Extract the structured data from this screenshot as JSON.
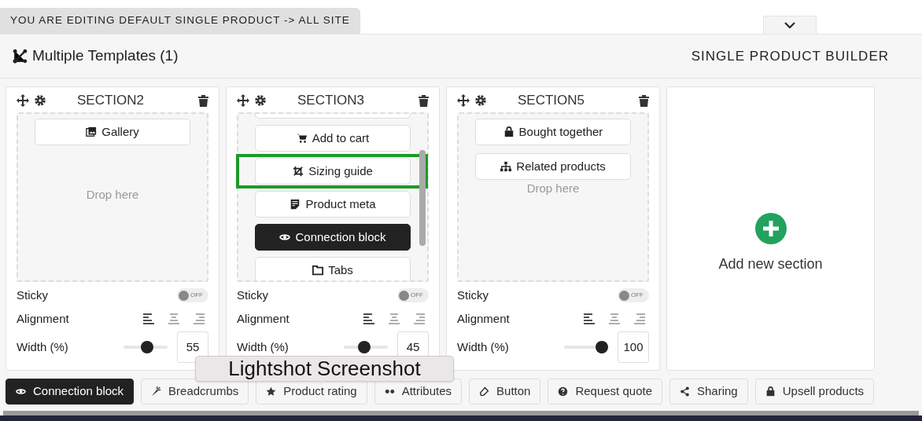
{
  "banner": {
    "text": "YOU ARE EDITING DEFAULT SINGLE PRODUCT -> ALL SITE"
  },
  "header": {
    "title": "Multiple Templates (1)",
    "builder_label": "SINGLE PRODUCT BUILDER"
  },
  "sections": [
    {
      "title": "SECTION2",
      "scrolled": false,
      "blocks": [
        {
          "label": "Gallery",
          "dark": false,
          "highlighted": false
        }
      ],
      "drop_hint": "Drop here",
      "sticky": {
        "label": "Sticky",
        "on": false,
        "text": "OFF"
      },
      "alignment": {
        "label": "Alignment",
        "options": [
          {
            "kind": "left",
            "selected": true
          },
          {
            "kind": "center",
            "selected": false
          },
          {
            "kind": "right",
            "selected": false
          }
        ]
      },
      "width": {
        "label": "Width (%)",
        "level": 0.55,
        "value": "55"
      }
    },
    {
      "title": "SECTION3",
      "scrolled": true,
      "blocks": [
        {
          "label": "Add to cart",
          "dark": false,
          "highlighted": false
        },
        {
          "label": "Sizing guide",
          "dark": false,
          "highlighted": true
        },
        {
          "label": "Product meta",
          "dark": false,
          "highlighted": false
        },
        {
          "label": "Connection block",
          "dark": true,
          "highlighted": false
        },
        {
          "label": "Tabs",
          "dark": false,
          "highlighted": false
        }
      ],
      "sticky": {
        "label": "Sticky",
        "on": false,
        "text": "OFF"
      },
      "alignment": {
        "label": "Alignment",
        "options": [
          {
            "kind": "left",
            "selected": true
          },
          {
            "kind": "center",
            "selected": false
          },
          {
            "kind": "right",
            "selected": false
          }
        ]
      },
      "width": {
        "label": "Width (%)",
        "level": 0.45,
        "value": "45"
      }
    },
    {
      "title": "SECTION5",
      "scrolled": false,
      "blocks": [
        {
          "label": "Bought together",
          "dark": false,
          "highlighted": false
        },
        {
          "label": "Related products",
          "dark": false,
          "highlighted": false
        }
      ],
      "drop_hint": "Drop here",
      "sticky": {
        "label": "Sticky",
        "on": false,
        "text": "OFF"
      },
      "alignment": {
        "label": "Alignment",
        "options": [
          {
            "kind": "left",
            "selected": true
          },
          {
            "kind": "center",
            "selected": false
          },
          {
            "kind": "right",
            "selected": false
          }
        ]
      },
      "width": {
        "label": "Width (%)",
        "level": 1,
        "value": "100"
      }
    }
  ],
  "add_section": {
    "label": "Add new section"
  },
  "palette": [
    {
      "label": "Connection block",
      "dark": true
    },
    {
      "label": "Breadcrumbs",
      "dark": false
    },
    {
      "label": "Product rating",
      "dark": false
    },
    {
      "label": "Attributes",
      "dark": false
    },
    {
      "label": "Button",
      "dark": false
    },
    {
      "label": "Request quote",
      "dark": false
    },
    {
      "label": "Sharing",
      "dark": false
    },
    {
      "label": "Upsell products",
      "dark": false
    }
  ],
  "tooltip": {
    "text": "Lightshot Screenshot"
  }
}
